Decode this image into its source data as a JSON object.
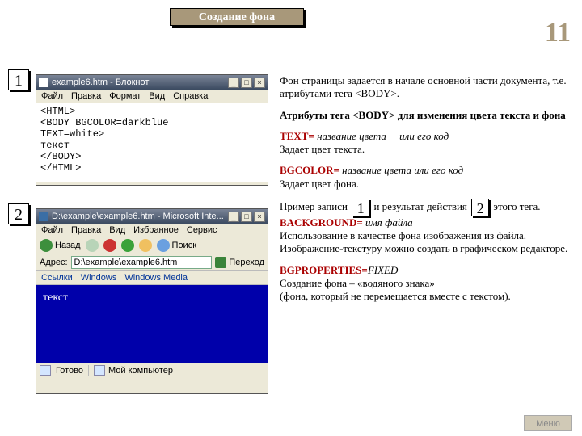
{
  "title": "Создание фона",
  "page_number": "11",
  "badges": {
    "one": "1",
    "two": "2"
  },
  "notepad": {
    "title": "example6.htm - Блокнот",
    "menu": [
      "Файл",
      "Правка",
      "Формат",
      "Вид",
      "Справка"
    ],
    "content": "<HTML>\n<BODY BGCOLOR=darkblue\nTEXT=white>\nтекст\n</BODY>\n</HTML>",
    "win_min": "_",
    "win_max": "□",
    "win_close": "×"
  },
  "ie": {
    "title": "D:\\example\\example6.htm - Microsoft Inte...",
    "menu": [
      "Файл",
      "Правка",
      "Вид",
      "Избранное",
      "Сервис"
    ],
    "back": "Назад",
    "search": "Поиск",
    "addr_label": "Адрес:",
    "addr_value": "D:\\example\\example6.htm",
    "go": "Переход",
    "links": [
      "Ссылки",
      "Windows",
      "Windows Media"
    ],
    "body_text": "текст",
    "status_left": "Готово",
    "status_right": "Мой компьютер",
    "win_min": "_",
    "win_max": "□",
    "win_close": "×"
  },
  "text": {
    "p1a": "Фон страницы задается в начале основной части документа, т.е. атрибутами тега ",
    "p1b": "<BODY>.",
    "p2a": "Атрибуты тега ",
    "p2b": "<BODY>",
    "p2c": " для изменения цвета текста и фона",
    "attr_text": "TEXT=",
    "attr_text_val": "название цвета",
    "attr_text_or": "или его код",
    "attr_text_desc": "Задает цвет текста.",
    "attr_bg": "BGCOLOR=",
    "attr_bg_val": "название цвета или его код",
    "attr_bg_desc": "Задает цвет фона.",
    "ex_a": "Пример записи ",
    "ex_b": " и результат действия ",
    "ex_c": " этого тега.",
    "attr_bkg": "BACKGROUND=",
    "attr_bkg_val": "имя файла",
    "attr_bkg_desc": "Использование в качестве фона изображения из файла. Изображение-текстуру можно создать в графическом редакторе.",
    "attr_prop": "BGPROPERTIES=",
    "attr_prop_val": "FIXED",
    "attr_prop_desc1": "Создание фона – «водяного знака»",
    "attr_prop_desc2": "(фона, который не перемещается вместе с текстом)."
  },
  "menu_button": "Меню"
}
